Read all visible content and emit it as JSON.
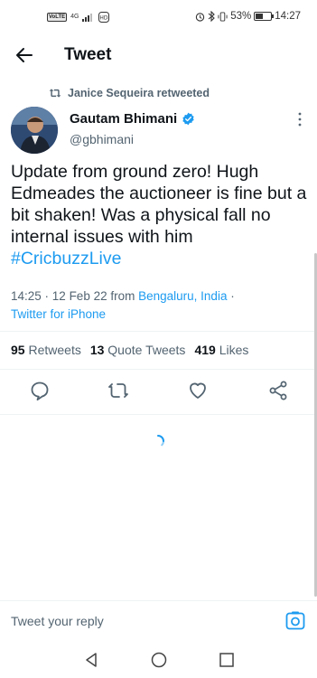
{
  "status_bar": {
    "network": "VoLTE",
    "signal": "4G",
    "battery_percent": "53%",
    "battery_level": 0.53,
    "time": "14:27"
  },
  "header": {
    "title": "Tweet"
  },
  "retweet": {
    "label": "Janice Sequeira retweeted"
  },
  "author": {
    "name": "Gautam Bhimani",
    "handle": "@gbhimani"
  },
  "tweet": {
    "text": "Update from ground zero! Hugh Edmeades the auctioneer is fine but a bit shaken! Was a physical fall no internal issues with him",
    "hashtag": "#CricbuzzLive",
    "time": "14:25",
    "date": "12 Feb 22",
    "from_label": "from",
    "location": "Bengaluru, India",
    "source": "Twitter for iPhone"
  },
  "stats": {
    "retweets_count": "95",
    "retweets_label": "Retweets",
    "quotes_count": "13",
    "quotes_label": "Quote Tweets",
    "likes_count": "419",
    "likes_label": "Likes"
  },
  "reply": {
    "placeholder": "Tweet your reply"
  },
  "colors": {
    "accent": "#1d9bf0",
    "text": "#0f1419",
    "muted": "#536471"
  }
}
